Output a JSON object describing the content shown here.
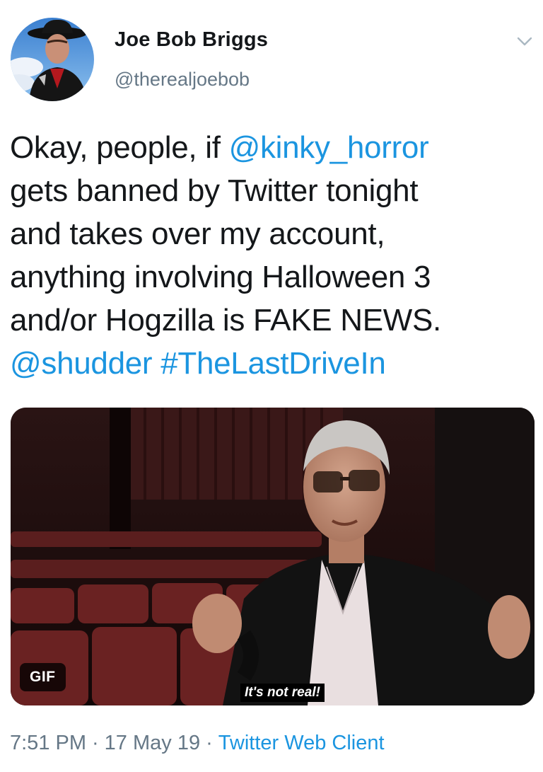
{
  "author": {
    "display_name": "Joe Bob Briggs",
    "handle": "@therealjoebob"
  },
  "tweet": {
    "line1_prefix": "Okay, people, if ",
    "line1_mention": "@kinky_horror",
    "line2": "gets banned by Twitter tonight",
    "line3": "and takes over my account,",
    "line4": "anything involving Halloween 3",
    "line5": "and/or Hogzilla is FAKE NEWS.",
    "mention_shudder": "@shudder",
    "hashtag": "#TheLastDriveIn"
  },
  "media": {
    "badge": "GIF",
    "caption": "It's not real!"
  },
  "meta": {
    "time": "7:51 PM",
    "separator": "·",
    "date": "17 May 19",
    "client": "Twitter Web Client"
  },
  "icons": {
    "menu": "chevron-down-icon"
  },
  "colors": {
    "link": "#1b95e0",
    "secondary_text": "#657786",
    "primary_text": "#14171a"
  }
}
